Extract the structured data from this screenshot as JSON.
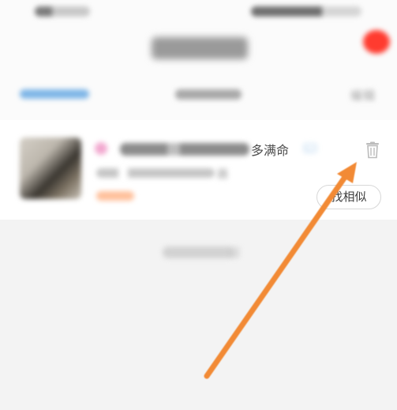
{
  "header": {
    "edit_label": "编辑"
  },
  "card": {
    "title_tail": "多满命",
    "subtitle_tail": "器",
    "find_similar_label": "找相似"
  },
  "footer": {
    "empty_tail": "容"
  },
  "colors": {
    "accent_blue": "#7fb6e7",
    "arrow_orange": "#f28a36",
    "badge_red": "#ff3b2f",
    "tag_orange": "#ffc09b",
    "pink_dot": "#f2a8cf"
  },
  "icons": {
    "mail": "mail-icon",
    "trash": "trash-icon"
  }
}
